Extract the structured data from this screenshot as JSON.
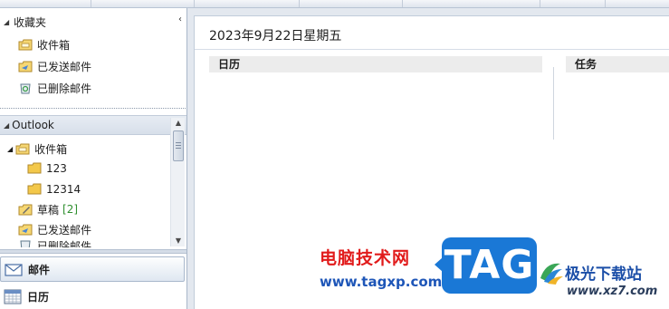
{
  "favorites": {
    "title": "收藏夹",
    "items": [
      {
        "label": "收件箱",
        "icon": "inbox-icon"
      },
      {
        "label": "已发送邮件",
        "icon": "sent-icon"
      },
      {
        "label": "已删除邮件",
        "icon": "deleted-icon"
      }
    ]
  },
  "outlook": {
    "title": "Outlook",
    "inbox_label": "收件箱",
    "subfolders": [
      "123",
      "12314"
    ],
    "drafts_label": "草稿",
    "drafts_count": "[2]",
    "sent_label": "已发送邮件",
    "deleted_label": "已删除邮件"
  },
  "nav_buttons": {
    "mail": "邮件",
    "calendar": "日历"
  },
  "main": {
    "date_title": "2023年9月22日星期五",
    "calendar_header": "日历",
    "tasks_header": "任务"
  },
  "watermark": {
    "site_name": "电脑技术网",
    "url": "www.tagxp.com",
    "tag": "TAG",
    "brand_cn": "极光下载站",
    "brand_url": "www.xz7.com"
  },
  "colors": {
    "accent": "#1a78d6",
    "drafts_count": "#2f8f2f",
    "watermark_red": "#e11b1b"
  }
}
